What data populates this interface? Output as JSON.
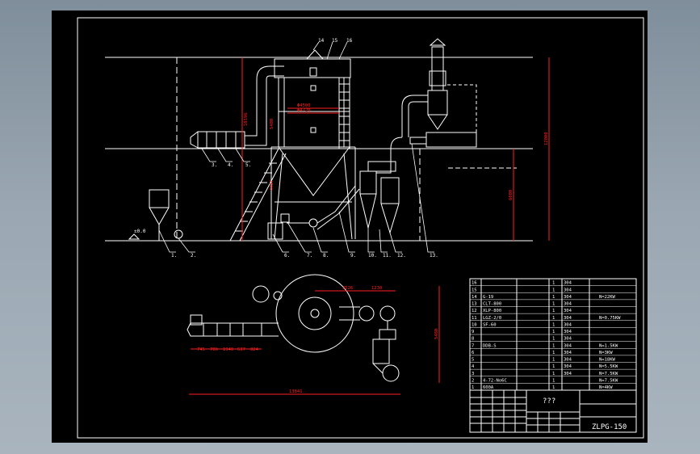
{
  "drawing": {
    "title_block": {
      "model_code": "ZLPG-150",
      "drawing_name": "???"
    },
    "part_labels": [
      "1.",
      "2.",
      "3.",
      "4.",
      "5.",
      "6.",
      "7.",
      "8.",
      "9.",
      "10.",
      "11.",
      "12.",
      "13.",
      "14",
      "15",
      "16"
    ],
    "level_mark": "±0.0",
    "front_dims": {
      "d_outer": "Φ4500",
      "d_inner": "Φ4720",
      "h_tower": "5400",
      "h_cone": "10196",
      "h_total": "12000",
      "h_mid": "6000",
      "h_low": "4427"
    },
    "plan_dims": {
      "seg_a": "745",
      "seg_b": "780",
      "seg_c": "1940",
      "seg_d": "637",
      "seg_e": "824",
      "top_a": "3526",
      "top_b": "1230",
      "overall_w": "13841",
      "overall_h": "5480"
    },
    "bom_rows": [
      {
        "no": "16",
        "spec": "",
        "qty": "1",
        "mat": "304",
        "note": ""
      },
      {
        "no": "15",
        "spec": "",
        "qty": "1",
        "mat": "304",
        "note": ""
      },
      {
        "no": "14",
        "spec": "G-19",
        "qty": "1",
        "mat": "304",
        "note": "N=22KW"
      },
      {
        "no": "13",
        "spec": "CLT-800",
        "qty": "1",
        "mat": "304",
        "note": ""
      },
      {
        "no": "12",
        "spec": "XLP-800",
        "qty": "1",
        "mat": "304",
        "note": ""
      },
      {
        "no": "11",
        "spec": "LGZ-2/0",
        "qty": "1",
        "mat": "304",
        "note": "N=0.75KW"
      },
      {
        "no": "10",
        "spec": "SF-60",
        "qty": "1",
        "mat": "304",
        "note": ""
      },
      {
        "no": "9",
        "spec": "",
        "qty": "1",
        "mat": "304",
        "note": ""
      },
      {
        "no": "8",
        "spec": "",
        "qty": "1",
        "mat": "304",
        "note": ""
      },
      {
        "no": "7",
        "spec": "DDB-S",
        "qty": "1",
        "mat": "304",
        "note": "N=1.5KW"
      },
      {
        "no": "6",
        "spec": "",
        "qty": "1",
        "mat": "304",
        "note": "N=3KW"
      },
      {
        "no": "5",
        "spec": "",
        "qty": "1",
        "mat": "304",
        "note": "N=18KW"
      },
      {
        "no": "4",
        "spec": "",
        "qty": "1",
        "mat": "304",
        "note": "N=5.5KW"
      },
      {
        "no": "3",
        "spec": "",
        "qty": "1",
        "mat": "304",
        "note": "N=7.5KW"
      },
      {
        "no": "2",
        "spec": "4-72-No6C",
        "qty": "1",
        "mat": "",
        "note": "N=7.5KW"
      },
      {
        "no": "1",
        "spec": "600A",
        "qty": "1",
        "mat": "",
        "note": "N=4KW"
      }
    ],
    "colors": {
      "background": "#000000",
      "linework": "#ffffff",
      "dimension": "#ff2020",
      "window": "#8c9aa6"
    }
  }
}
